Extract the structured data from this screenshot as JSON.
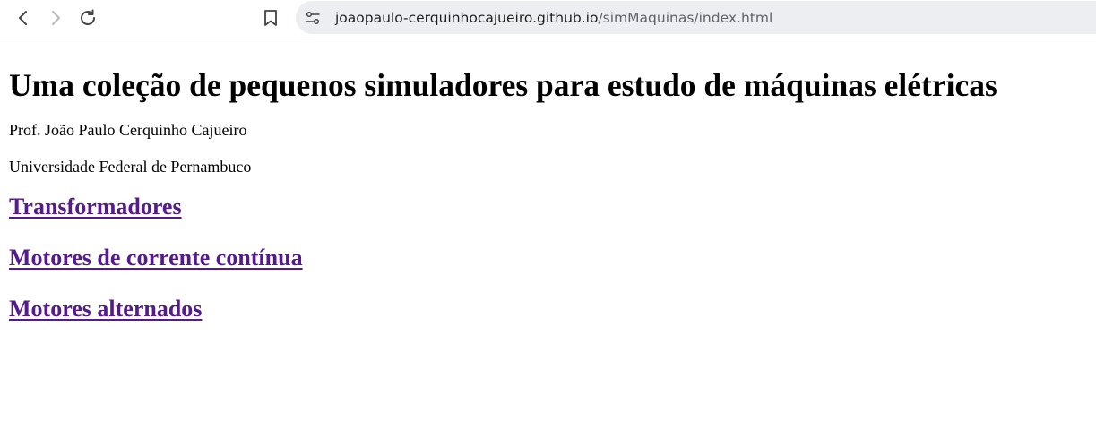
{
  "browser": {
    "url_domain": "joaopaulo-cerquinhocajueiro.github.io",
    "url_path": "/simMaquinas/index.html",
    "icons": {
      "back": "back-arrow-icon",
      "forward": "forward-arrow-icon",
      "reload": "reload-icon",
      "bookmark": "bookmark-icon",
      "site_info": "site-info-icon"
    }
  },
  "page": {
    "title": "Uma coleção de pequenos simuladores para estudo de máquinas elétricas",
    "author": "Prof. João Paulo Cerquinho Cajueiro",
    "university": "Universidade Federal de Pernambuco",
    "links": [
      {
        "label": "Transformadores"
      },
      {
        "label": "Motores de corrente contínua"
      },
      {
        "label": "Motores alternados"
      }
    ]
  },
  "colors": {
    "visited_link": "#551a8b",
    "address_bar_bg": "#edeef2"
  }
}
